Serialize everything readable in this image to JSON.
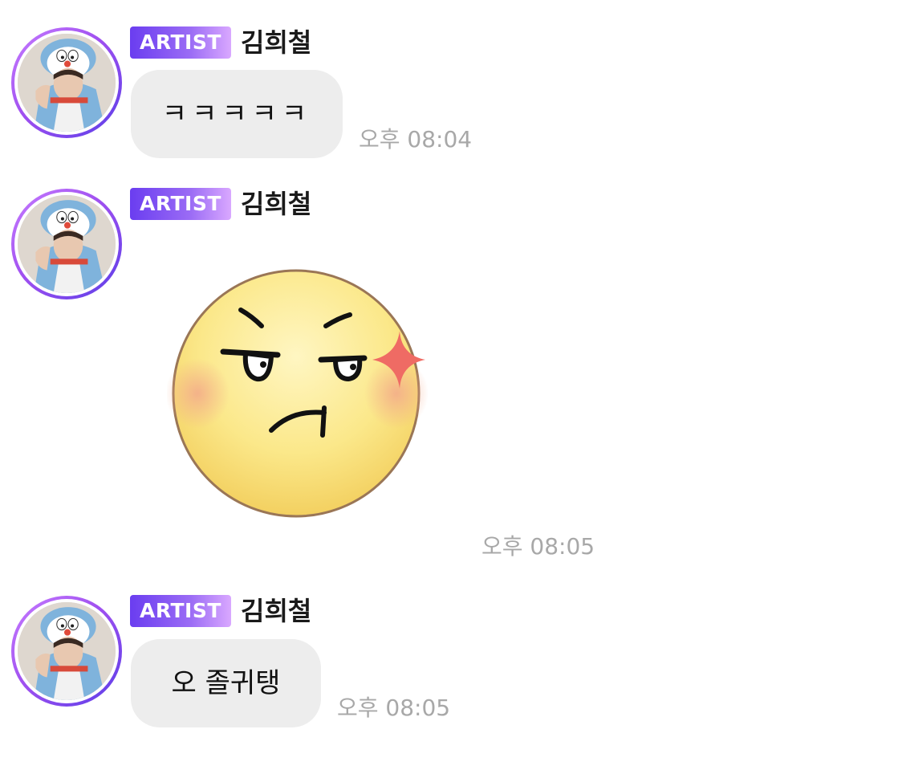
{
  "messages": [
    {
      "badge": "ARTIST",
      "sender": "김희철",
      "text": "ㅋㅋㅋㅋㅋ",
      "time": "오후 08:04"
    },
    {
      "badge": "ARTIST",
      "sender": "김희철",
      "sticker": "annoyed-yellow-face-sticker",
      "time": "오후 08:05"
    },
    {
      "badge": "ARTIST",
      "sender": "김희철",
      "text": "오 졸귀탱",
      "time": "오후 08:05"
    }
  ],
  "colors": {
    "badge_gradient_start": "#6a3df0",
    "badge_gradient_end": "#d9a8ff",
    "bubble_bg": "#ededed",
    "timestamp": "#a8a8a8",
    "avatar_ring": "#a050f0"
  },
  "icons": {
    "avatar": "profile-photo-doraemon-hood",
    "sticker": "annoyed-yellow-face-sticker"
  }
}
